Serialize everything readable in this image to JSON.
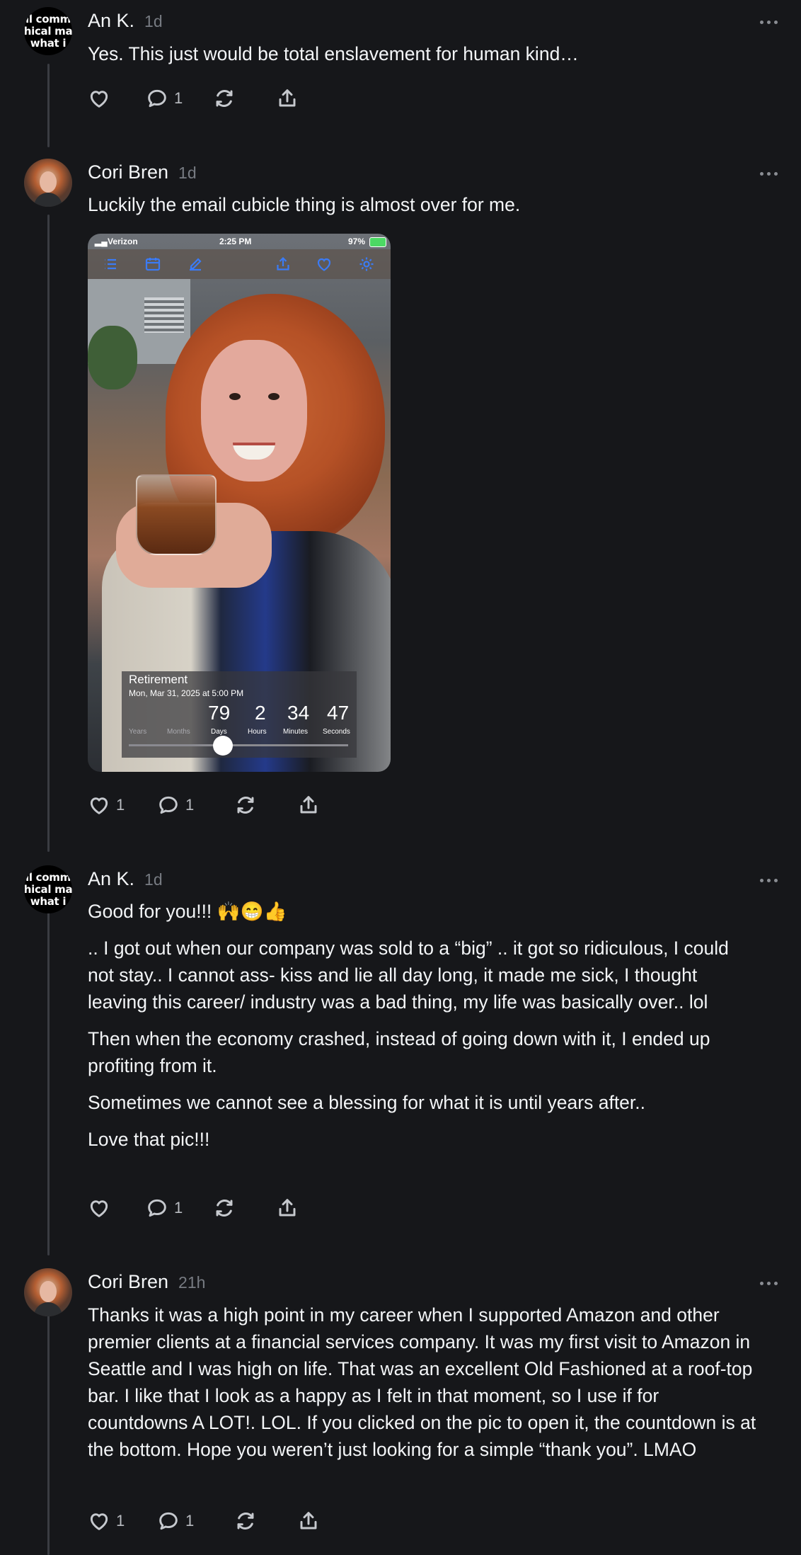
{
  "posts": [
    {
      "author": "An K.",
      "time": "1d",
      "avatar_text": [
        "ll comm",
        "hical ma",
        "what i"
      ],
      "paragraphs": [
        "Yes. This just would be total enslavement for human kind…"
      ],
      "actions": {
        "likes": "",
        "comments": "1"
      }
    },
    {
      "author": "Cori Bren",
      "time": "1d",
      "paragraphs": [
        "Luckily the email cubicle thing is almost over for me."
      ],
      "image": {
        "carrier": "Verizon",
        "clock": "2:25 PM",
        "battery": "97%",
        "countdown_title": "Retirement",
        "countdown_date": "Mon, Mar 31, 2025 at 5:00 PM",
        "values": {
          "days": "79",
          "hours": "2",
          "minutes": "34",
          "seconds": "47"
        },
        "units": {
          "years": "Years",
          "months": "Months",
          "days": "Days",
          "hours": "Hours",
          "minutes": "Minutes",
          "seconds": "Seconds"
        },
        "progress": 0.43
      },
      "actions": {
        "likes": "1",
        "comments": "1"
      }
    },
    {
      "author": "An K.",
      "time": "1d",
      "avatar_text": [
        "ll comm",
        "hical ma",
        "what i"
      ],
      "paragraphs": [
        "Good for you!!! 🙌😁👍",
        ".. I got out when our company was sold to a “big” .. it got so ridiculous, I could not stay.. I cannot ass- kiss and lie all day long, it made me sick, I thought leaving this career/ industry was a bad thing, my life was basically over.. lol",
        "Then when the economy crashed, instead of going down with it, I ended up profiting from it.",
        "Sometimes we cannot see a blessing for what it is until years after..",
        "Love that pic!!!"
      ],
      "actions": {
        "likes": "",
        "comments": "1"
      }
    },
    {
      "author": "Cori Bren",
      "time": "21h",
      "paragraphs": [
        "Thanks it was a high point in my career when I supported Amazon and other premier clients at a financial services company. It was my first visit to Amazon in Seattle and I was high on life. That was an excellent Old Fashioned at a roof-top bar. I like that I look as a happy as I felt in that moment, so I use if for countdowns A LOT!. LOL. If you clicked on the pic to open it, the countdown is at the bottom. Hope you weren’t just looking for a simple “thank you”. LMAO"
      ],
      "actions": {
        "likes": "1",
        "comments": "1"
      }
    }
  ]
}
